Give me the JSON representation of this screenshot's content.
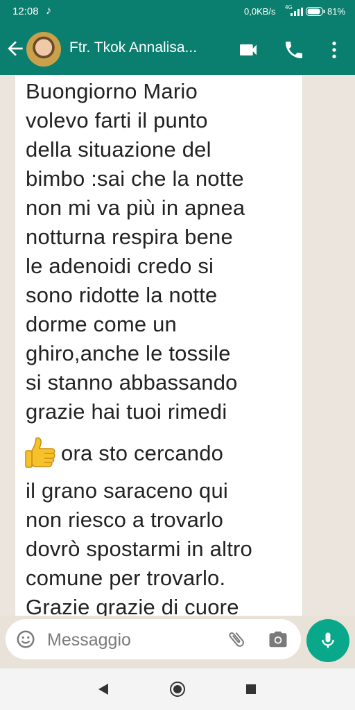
{
  "status_bar": {
    "time": "12:08",
    "tiktok_icon": "tiktok-icon",
    "net_speed": "0,0KB/s",
    "network_type": "4G",
    "battery_percent": "81%"
  },
  "header": {
    "contact_name": "Ftr. Tkok Annalisa...",
    "icons": [
      "arrow-back-icon",
      "avatar",
      "video-call-icon",
      "phone-icon",
      "more-vert-icon"
    ],
    "accent_color": "#0b7f6f"
  },
  "message": {
    "lines": [
      "Buongiorno Mario",
      "volevo farti il punto",
      "della situazione del",
      "bimbo :sai che la notte",
      "non mi va più in apnea",
      "notturna respira bene",
      "le adenoidi credo si",
      "sono ridotte la notte",
      "dorme come un",
      "ghiro,anche le tossile",
      "si stanno abbassando",
      "grazie hai tuoi rimedi",
      "ora sto cercando",
      "il grano saraceno qui",
      "non riesco a trovarlo",
      "dovrò spostarmi in altro",
      "comune per trovarlo.",
      "Grazie grazie di cuore"
    ],
    "emoji": "thumbs-up-emoji"
  },
  "composer": {
    "placeholder": "Messaggio",
    "value": "",
    "mic_color": "#0aa88a"
  },
  "nav_bar": {
    "icons": [
      "nav-back-icon",
      "nav-home-icon",
      "nav-recent-icon"
    ]
  }
}
